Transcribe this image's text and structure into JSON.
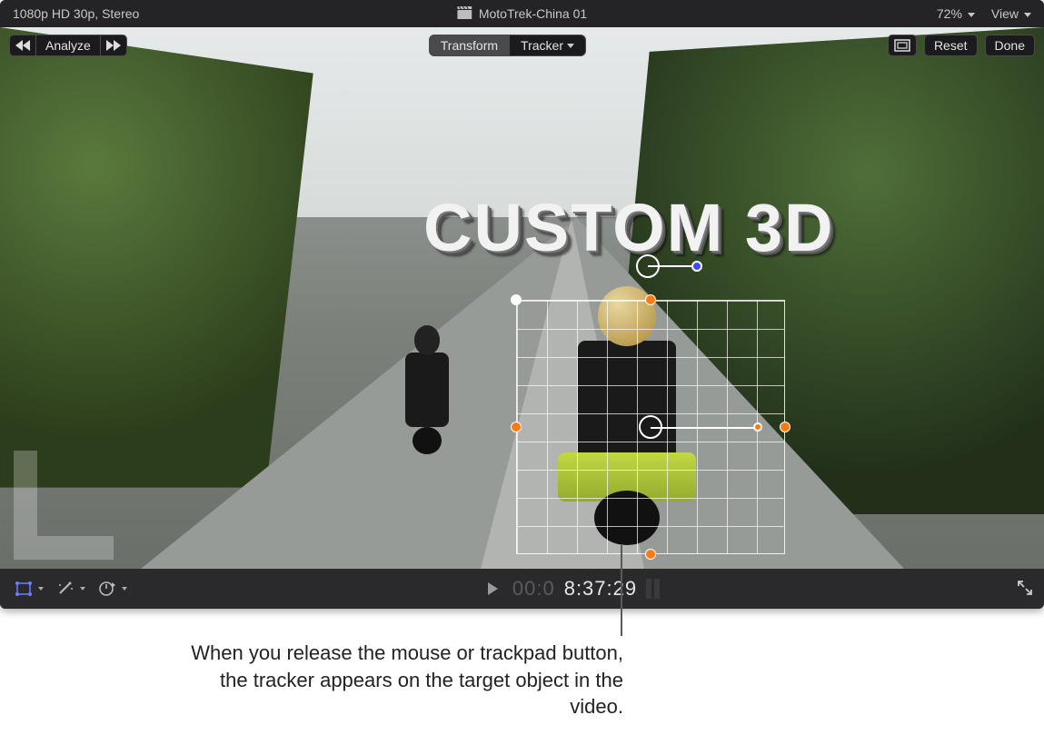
{
  "topbar": {
    "format": "1080p HD 30p, Stereo",
    "clip_name": "MotoTrek-China 01",
    "zoom": "72%",
    "view_label": "View"
  },
  "overlay": {
    "analyze": "Analyze",
    "transform": "Transform",
    "tracker": "Tracker",
    "reset": "Reset",
    "done": "Done"
  },
  "title_overlay": "CUSTOM 3D",
  "timecode": {
    "dim": "00:0",
    "bright": "8:37:29"
  },
  "callout": "When you release the mouse or trackpad button, the tracker appears on the target object in the video."
}
